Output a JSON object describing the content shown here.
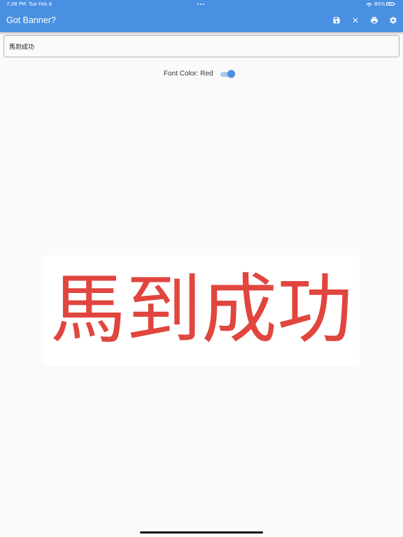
{
  "status_bar": {
    "time": "7:38 PM",
    "date": "Tue Feb 6",
    "battery": "80%",
    "wifi_icon": "wifi-icon",
    "battery_icon": "battery-icon"
  },
  "app_bar": {
    "title": "Got Banner?",
    "background": "#4a90e2",
    "actions": [
      {
        "name": "save",
        "icon": "save-icon"
      },
      {
        "name": "clear",
        "icon": "close-icon"
      },
      {
        "name": "print",
        "icon": "print-icon"
      },
      {
        "name": "settings",
        "icon": "gear-icon"
      }
    ]
  },
  "text_field": {
    "value": "馬到成功"
  },
  "font_color": {
    "label": "Font Color: Red",
    "toggle_on": true
  },
  "banner": {
    "text": "馬到成功",
    "color": "#e0463e",
    "background": "#ffffff"
  }
}
